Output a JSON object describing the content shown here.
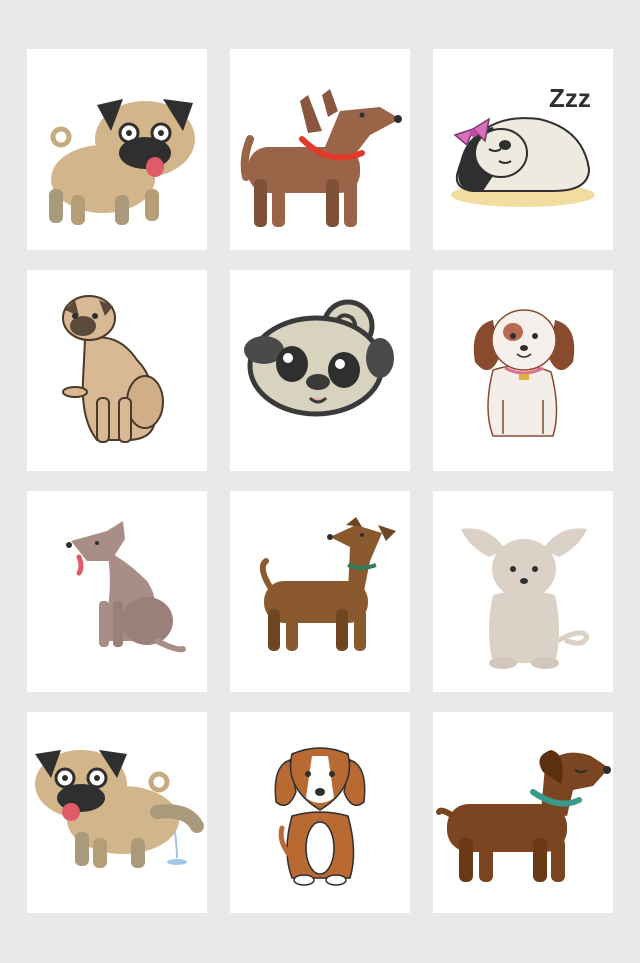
{
  "gallery": {
    "background": "#e9e9ea",
    "card_background": "#ffffff",
    "cards": [
      {
        "subject": "pug-standing-tongue-out"
      },
      {
        "subject": "brown-dog-red-collar"
      },
      {
        "subject": "sleeping-pug-with-bow",
        "text": "Zzz"
      },
      {
        "subject": "pug-sitting"
      },
      {
        "subject": "pug-face-curled-tail"
      },
      {
        "subject": "spaniel-puppy-sitting"
      },
      {
        "subject": "grey-dog-sitting"
      },
      {
        "subject": "brown-dog-green-collar"
      },
      {
        "subject": "chihuahua-sitting"
      },
      {
        "subject": "pug-lifting-leg"
      },
      {
        "subject": "beagle-puppy-sitting"
      },
      {
        "subject": "brown-dog-teal-collar"
      }
    ]
  },
  "colors": {
    "pug_fawn": "#d2b58a",
    "pug_mask": "#2f2f2f",
    "brown_dog": "#9a6448",
    "red_collar": "#e03a2b",
    "sleep_cream": "#eeeae0",
    "bow_pink": "#d96ec0",
    "mat_yellow": "#f2dca0",
    "grey_dog": "#a88e86",
    "olive_brown": "#8a5a2e",
    "green_collar": "#2e7d5a",
    "chihuahua": "#dcd1c6",
    "spaniel_brown": "#8a4a2e",
    "beagle_orange": "#b86a32",
    "dark_brown": "#7a4520",
    "teal_collar": "#3a9a8a"
  }
}
